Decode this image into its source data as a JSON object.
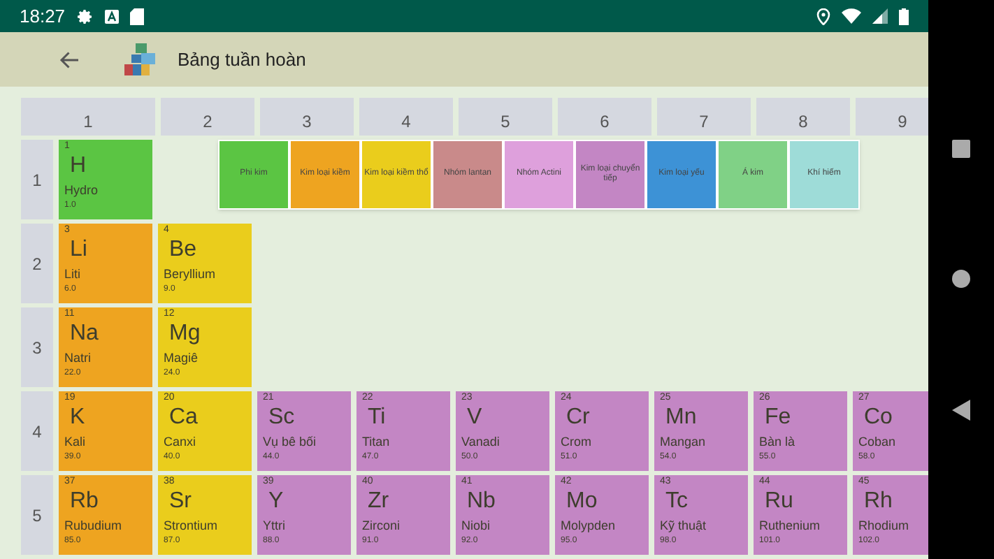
{
  "status_bar": {
    "time": "18:27"
  },
  "app_bar": {
    "title": "Bảng tuần hoàn"
  },
  "legend": [
    {
      "label": "Phi kim",
      "color": "#5bc543"
    },
    {
      "label": "Kim loại kiềm",
      "color": "#eea420"
    },
    {
      "label": "Kim loại kiềm thổ",
      "color": "#eacd1c"
    },
    {
      "label": "Nhóm lantan",
      "color": "#c98a8a"
    },
    {
      "label": "Nhóm Actini",
      "color": "#dea0dc"
    },
    {
      "label": "Kim loại chuyển tiếp",
      "color": "#c386c4"
    },
    {
      "label": "Kim loại yếu",
      "color": "#3d92d6"
    },
    {
      "label": "Á kim",
      "color": "#80d186"
    },
    {
      "label": "Khí hiếm",
      "color": "#9edcd8"
    }
  ],
  "columns": [
    "1",
    "2",
    "3",
    "4",
    "5",
    "6",
    "7",
    "8",
    "9"
  ],
  "rows": [
    {
      "label": "1",
      "cells": [
        {
          "number": "1",
          "symbol": "H",
          "name": "Hydro",
          "weight": "1.0",
          "color": "#5bc543"
        }
      ]
    },
    {
      "label": "2",
      "cells": [
        {
          "number": "3",
          "symbol": "Li",
          "name": "Liti",
          "weight": "6.0",
          "color": "#eea420"
        },
        {
          "number": "4",
          "symbol": "Be",
          "name": "Beryllium",
          "weight": "9.0",
          "color": "#eacd1c"
        }
      ]
    },
    {
      "label": "3",
      "cells": [
        {
          "number": "11",
          "symbol": "Na",
          "name": "Natri",
          "weight": "22.0",
          "color": "#eea420"
        },
        {
          "number": "12",
          "symbol": "Mg",
          "name": "Magiê",
          "weight": "24.0",
          "color": "#eacd1c"
        }
      ]
    },
    {
      "label": "4",
      "cells": [
        {
          "number": "19",
          "symbol": "K",
          "name": "Kali",
          "weight": "39.0",
          "color": "#eea420"
        },
        {
          "number": "20",
          "symbol": "Ca",
          "name": "Canxi",
          "weight": "40.0",
          "color": "#eacd1c"
        },
        {
          "number": "21",
          "symbol": "Sc",
          "name": "Vụ bê bối",
          "weight": "44.0",
          "color": "#c386c4"
        },
        {
          "number": "22",
          "symbol": "Ti",
          "name": "Titan",
          "weight": "47.0",
          "color": "#c386c4"
        },
        {
          "number": "23",
          "symbol": "V",
          "name": "Vanadi",
          "weight": "50.0",
          "color": "#c386c4"
        },
        {
          "number": "24",
          "symbol": "Cr",
          "name": "Crom",
          "weight": "51.0",
          "color": "#c386c4"
        },
        {
          "number": "25",
          "symbol": "Mn",
          "name": "Mangan",
          "weight": "54.0",
          "color": "#c386c4"
        },
        {
          "number": "26",
          "symbol": "Fe",
          "name": "Bàn là",
          "weight": "55.0",
          "color": "#c386c4"
        },
        {
          "number": "27",
          "symbol": "Co",
          "name": "Coban",
          "weight": "58.0",
          "color": "#c386c4"
        }
      ]
    },
    {
      "label": "5",
      "cells": [
        {
          "number": "37",
          "symbol": "Rb",
          "name": "Rubudium",
          "weight": "85.0",
          "color": "#eea420"
        },
        {
          "number": "38",
          "symbol": "Sr",
          "name": "Strontium",
          "weight": "87.0",
          "color": "#eacd1c"
        },
        {
          "number": "39",
          "symbol": "Y",
          "name": "Yttri",
          "weight": "88.0",
          "color": "#c386c4"
        },
        {
          "number": "40",
          "symbol": "Zr",
          "name": "Zirconi",
          "weight": "91.0",
          "color": "#c386c4"
        },
        {
          "number": "41",
          "symbol": "Nb",
          "name": "Niobi",
          "weight": "92.0",
          "color": "#c386c4"
        },
        {
          "number": "42",
          "symbol": "Mo",
          "name": "Molypden",
          "weight": "95.0",
          "color": "#c386c4"
        },
        {
          "number": "43",
          "symbol": "Tc",
          "name": "Kỹ thuật",
          "weight": "98.0",
          "color": "#c386c4"
        },
        {
          "number": "44",
          "symbol": "Ru",
          "name": "Ruthenium",
          "weight": "101.0",
          "color": "#c386c4"
        },
        {
          "number": "45",
          "symbol": "Rh",
          "name": "Rhodium",
          "weight": "102.0",
          "color": "#c386c4"
        }
      ]
    }
  ]
}
